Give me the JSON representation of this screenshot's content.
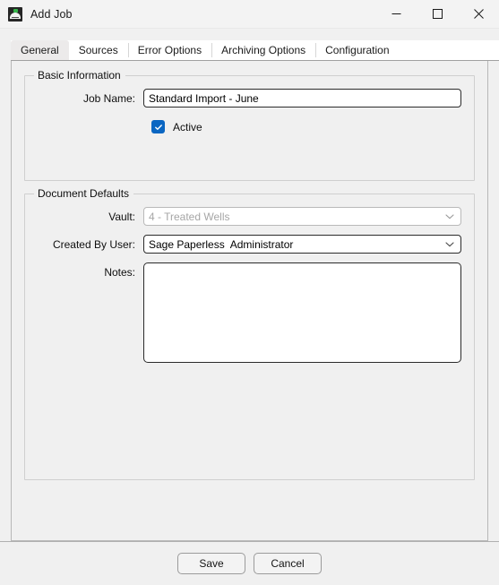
{
  "window": {
    "title": "Add Job",
    "app_icon": "sage-paperless-icon",
    "controls": {
      "minimize": "minimize-icon",
      "maximize": "maximize-icon",
      "close": "close-icon"
    }
  },
  "tabs": [
    {
      "label": "General",
      "selected": true
    },
    {
      "label": "Sources",
      "selected": false
    },
    {
      "label": "Error Options",
      "selected": false
    },
    {
      "label": "Archiving Options",
      "selected": false
    },
    {
      "label": "Configuration",
      "selected": false
    }
  ],
  "basic_information": {
    "legend": "Basic Information",
    "job_name": {
      "label": "Job Name:",
      "value": "Standard Import - June",
      "placeholder": ""
    },
    "active": {
      "label": "Active",
      "checked": true
    }
  },
  "document_defaults": {
    "legend": "Document Defaults",
    "vault": {
      "label": "Vault:",
      "value": "4 - Treated Wells",
      "disabled": true,
      "chevron": "chevron-down-icon"
    },
    "created_by_user": {
      "label": "Created By User:",
      "value": "Sage Paperless  Administrator",
      "disabled": false,
      "chevron": "chevron-down-icon"
    },
    "notes": {
      "label": "Notes:",
      "value": "",
      "placeholder": ""
    }
  },
  "footer": {
    "save_label": "Save",
    "cancel_label": "Cancel"
  },
  "colors": {
    "accent": "#0a66c2",
    "window_bg": "#f0f0f0",
    "titlebar_bg": "#f3f3f3",
    "field_border": "#2b2b2b",
    "group_border": "#cfcfcf",
    "disabled_text": "#a6a6a6"
  }
}
